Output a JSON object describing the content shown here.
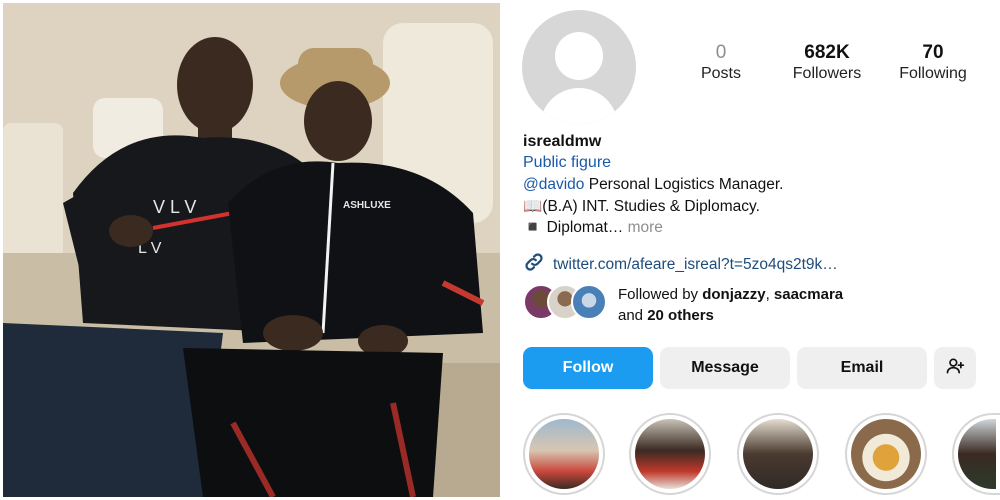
{
  "profile": {
    "username": "isrealdmw",
    "category": "Public figure",
    "bio_mention": "@davido",
    "bio_line1_rest": " Personal Logistics Manager.",
    "bio_line2": "📖(B.A) INT. Studies & Diplomacy.",
    "bio_line3": "◾ Diplomat…",
    "bio_more": "more",
    "link": "twitter.com/afeare_isreal?t=5zo4qs2t9k…"
  },
  "stats": {
    "posts_value": "0",
    "posts_label": "Posts",
    "followers_value": "682K",
    "followers_label": "Followers",
    "following_value": "70",
    "following_label": "Following"
  },
  "followed_by": {
    "prefix": "Followed by ",
    "user1": "donjazzy",
    "separator": ", ",
    "user2": "saacmara",
    "and_text": "and ",
    "others": "20 others"
  },
  "buttons": {
    "follow": "Follow",
    "message": "Message",
    "email": "Email"
  },
  "icons": {
    "link": "link-icon",
    "add_user": "add-person-icon"
  },
  "colors": {
    "accent": "#1b9cf0",
    "link": "#1a5aa8",
    "secondary_button": "#efefef"
  }
}
